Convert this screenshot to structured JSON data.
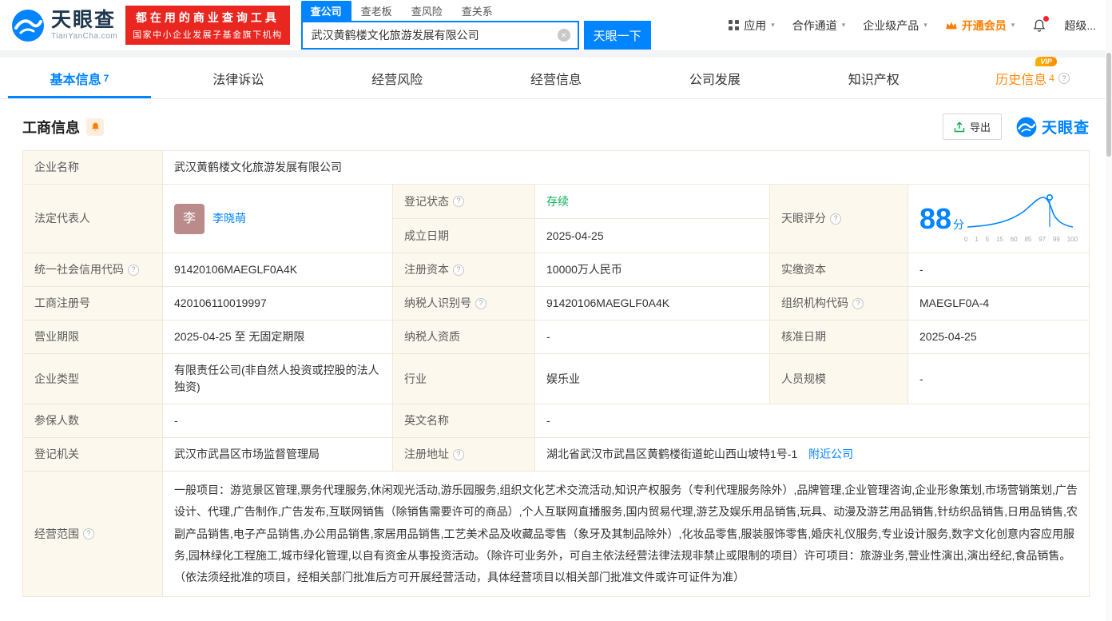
{
  "colors": {
    "brand_blue": "#0084ff",
    "promo_red": "#e9261f",
    "vip_orange": "#ff7d00",
    "status_green": "#0bb357",
    "label_bg": "#fcf8ee"
  },
  "icons": {
    "info": "?",
    "caret": "▾",
    "clear": "×"
  },
  "header": {
    "logo": {
      "name": "天眼查",
      "domain": "TianYanCha.com"
    },
    "promo": {
      "line1": "都在用的商业查询工具",
      "line2": "国家中小企业发展子基金旗下机构"
    },
    "search_tabs": {
      "company": "查公司",
      "boss": "查老板",
      "risk": "查风险",
      "relation": "查关系"
    },
    "search": {
      "value": "武汉黄鹤楼文化旅游发展有限公司",
      "button": "天眼一下"
    },
    "nav": {
      "apps": "应用",
      "partner": "合作通道",
      "enterprise": "企业级产品",
      "vip": "开通会员",
      "super": "超级..."
    }
  },
  "tabbar": {
    "basic": {
      "label": "基本信息",
      "count": "7"
    },
    "lawsuit": {
      "label": "法律诉讼"
    },
    "risk": {
      "label": "经营风险"
    },
    "operating": {
      "label": "经营信息"
    },
    "development": {
      "label": "公司发展"
    },
    "ip": {
      "label": "知识产权"
    },
    "history": {
      "label": "历史信息",
      "count": "4",
      "badge": "VIP"
    }
  },
  "section": {
    "title": "工商信息",
    "export": "导出",
    "brand": "天眼查"
  },
  "fields": {
    "company_name": {
      "label": "企业名称",
      "value": "武汉黄鹤楼文化旅游发展有限公司"
    },
    "legal_rep": {
      "label": "法定代表人",
      "value": "李晓萌",
      "avatar": "李"
    },
    "reg_status": {
      "label": "登记状态",
      "value": "存续"
    },
    "establish_date": {
      "label": "成立日期",
      "value": "2025-04-25"
    },
    "score": {
      "label": "天眼评分",
      "value": "88",
      "unit": "分"
    },
    "credit_code": {
      "label": "统一社会信用代码",
      "value": "91420106MAEGLF0A4K"
    },
    "reg_capital": {
      "label": "注册资本",
      "value": "10000万人民币"
    },
    "paid_capital": {
      "label": "实缴资本",
      "value": "-"
    },
    "reg_number": {
      "label": "工商注册号",
      "value": "420106110019997"
    },
    "taxpayer_id": {
      "label": "纳税人识别号",
      "value": "91420106MAEGLF0A4K"
    },
    "org_code": {
      "label": "组织机构代码",
      "value": "MAEGLF0A-4"
    },
    "business_term": {
      "label": "营业期限",
      "value": "2025-04-25 至 无固定期限"
    },
    "taxpayer_quality": {
      "label": "纳税人资质",
      "value": "-"
    },
    "approval_date": {
      "label": "核准日期",
      "value": "2025-04-25"
    },
    "company_type": {
      "label": "企业类型",
      "value": "有限责任公司(非自然人投资或控股的法人独资)"
    },
    "industry": {
      "label": "行业",
      "value": "娱乐业"
    },
    "staff_size": {
      "label": "人员规模",
      "value": "-"
    },
    "insured_count": {
      "label": "参保人数",
      "value": "-"
    },
    "english_name": {
      "label": "英文名称",
      "value": "-"
    },
    "reg_authority": {
      "label": "登记机关",
      "value": "武汉市武昌区市场监督管理局"
    },
    "reg_address": {
      "label": "注册地址",
      "value": "湖北省武汉市武昌区黄鹤楼街道蛇山西山坡特1号-1",
      "link": "附近公司"
    },
    "business_scope": {
      "label": "经营范围",
      "value": "一般项目：游览景区管理,票务代理服务,休闲观光活动,游乐园服务,组织文化艺术交流活动,知识产权服务（专利代理服务除外）,品牌管理,企业管理咨询,企业形象策划,市场营销策划,广告设计、代理,广告制作,广告发布,互联网销售（除销售需要许可的商品）,个人互联网直播服务,国内贸易代理,游艺及娱乐用品销售,玩具、动漫及游艺用品销售,针纺织品销售,日用品销售,农副产品销售,电子产品销售,办公用品销售,家居用品销售,工艺美术品及收藏品零售（象牙及其制品除外）,化妆品零售,服装服饰零售,婚庆礼仪服务,专业设计服务,数字文化创意内容应用服务,园林绿化工程施工,城市绿化管理,以自有资金从事投资活动。（除许可业务外，可自主依法经营法律法规非禁止或限制的项目）许可项目：旅游业务,营业性演出,演出经纪,食品销售。（依法须经批准的项目，经相关部门批准后方可开展经营活动，具体经营项目以相关部门批准文件或许可证件为准）"
    }
  },
  "score_chart": {
    "type": "line",
    "marker_value": 88,
    "ticks": [
      "0",
      "1",
      "5",
      "15",
      "60",
      "85",
      "97",
      "99",
      "100"
    ]
  }
}
